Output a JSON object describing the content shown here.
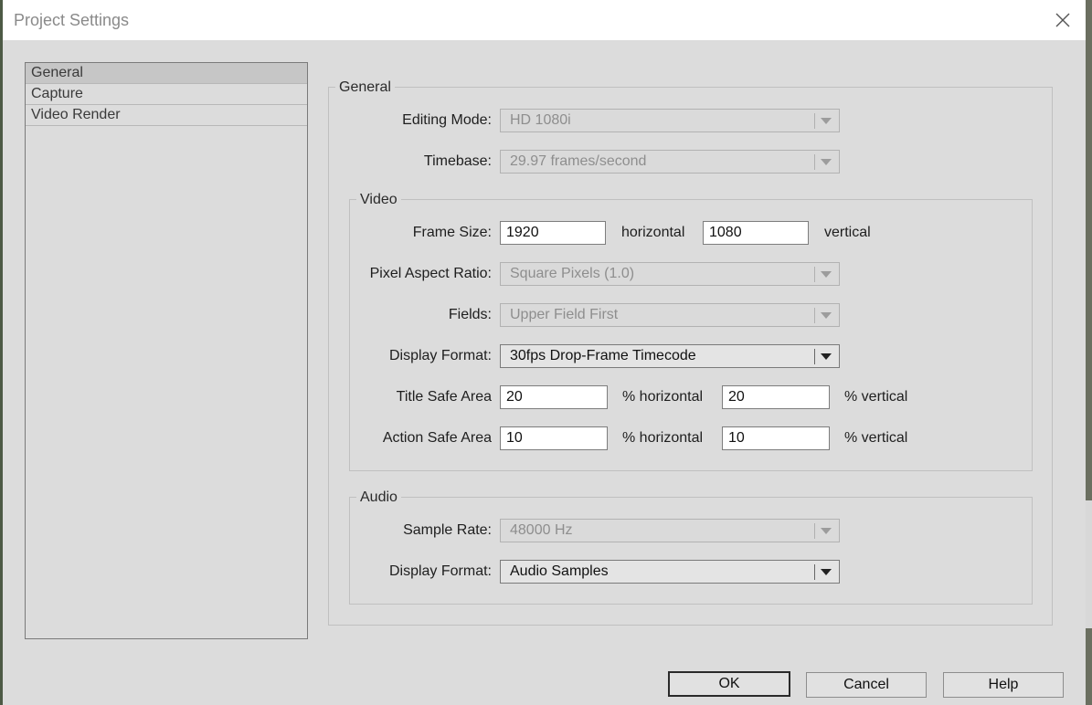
{
  "window": {
    "title": "Project Settings"
  },
  "sidebar": {
    "items": [
      {
        "label": "General",
        "selected": true
      },
      {
        "label": "Capture",
        "selected": false
      },
      {
        "label": "Video Render",
        "selected": false
      }
    ]
  },
  "general": {
    "group_label": "General",
    "editing_mode": {
      "label": "Editing Mode:",
      "value": "HD 1080i"
    },
    "timebase": {
      "label": "Timebase:",
      "value": "29.97 frames/second"
    }
  },
  "video": {
    "group_label": "Video",
    "frame_size": {
      "label": "Frame Size:",
      "width": "1920",
      "width_suffix": "horizontal",
      "height": "1080",
      "height_suffix": "vertical"
    },
    "pixel_aspect_ratio": {
      "label": "Pixel Aspect Ratio:",
      "value": "Square Pixels (1.0)"
    },
    "fields": {
      "label": "Fields:",
      "value": "Upper Field First"
    },
    "display_format": {
      "label": "Display Format:",
      "value": "30fps Drop-Frame Timecode"
    },
    "title_safe": {
      "label": "Title Safe Area",
      "horizontal": "20",
      "horizontal_suffix": "% horizontal",
      "vertical": "20",
      "vertical_suffix": "% vertical"
    },
    "action_safe": {
      "label": "Action Safe Area",
      "horizontal": "10",
      "horizontal_suffix": "% horizontal",
      "vertical": "10",
      "vertical_suffix": "% vertical"
    }
  },
  "audio": {
    "group_label": "Audio",
    "sample_rate": {
      "label": "Sample Rate:",
      "value": "48000 Hz"
    },
    "display_format": {
      "label": "Display Format:",
      "value": "Audio Samples"
    }
  },
  "buttons": {
    "ok": "OK",
    "cancel": "Cancel",
    "help": "Help"
  }
}
